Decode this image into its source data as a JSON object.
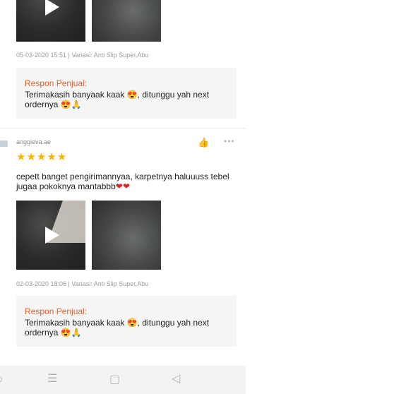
{
  "review_1": {
    "meta": "05-03-2020 15:51 | Variasi: Anti Slip Super,Abu",
    "reply": {
      "title": "Respon Penjual:",
      "text": "Terimakasih banyaak kaak 😍, ditunggu yah next ordernya 😍🙏"
    }
  },
  "review_2": {
    "username": "anggieva.ae",
    "rating_text": "★★★★★",
    "rating": 5,
    "comment": "cepett banget pengirimannyaa, karpetnya haluuuss tebel jugaa pokoknya mantabbb",
    "comment_hearts": "❤❤",
    "meta": "02-03-2020 18:06 | Variasi: Anti Slip Super,Abu",
    "reply": {
      "title": "Respon Penjual:",
      "text": "Terimakasih banyaak kaak 😍, ditunggu yah next ordernya 😍🙏"
    }
  },
  "icons": {
    "like": "thumbs-up-icon",
    "more": "more-options-icon",
    "play": "play-icon",
    "nav_back": "back-triangle-icon",
    "nav_home": "home-square-icon",
    "nav_menu": "menu-lines-icon"
  }
}
